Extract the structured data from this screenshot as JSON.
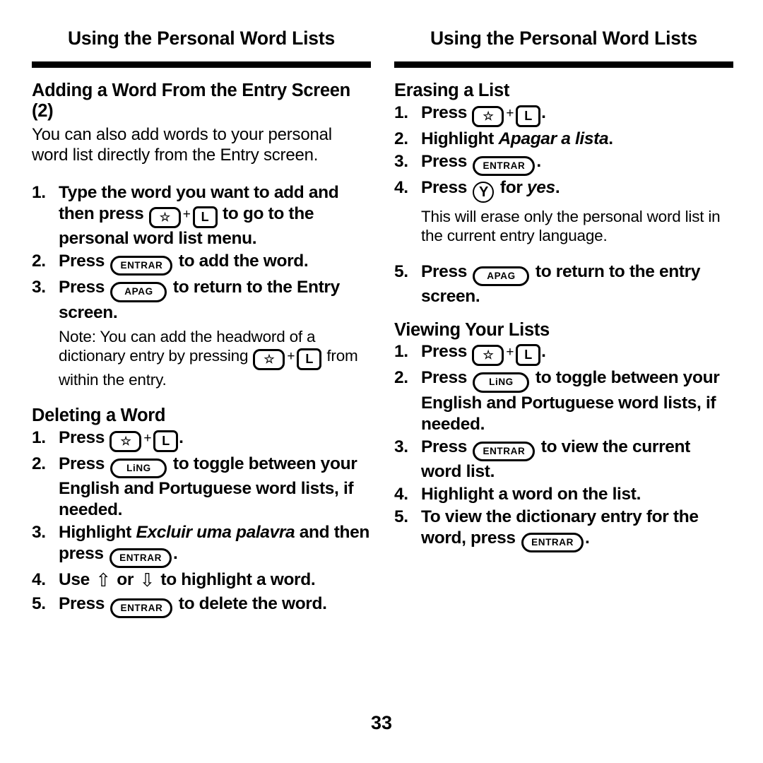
{
  "page": {
    "folio": "33",
    "running_head": "Using the Personal Word Lists"
  },
  "keys": {
    "star": "☆",
    "l": "L",
    "entrar": "ENTRAR",
    "apag": "APAG",
    "ling": "LiNG",
    "y": "Y",
    "plus": "+",
    "arrow_up": "⇧",
    "arrow_down": "⇩"
  },
  "left_column": {
    "header": "Using the Personal Word Lists",
    "section1": {
      "heading": "Adding a Word From the Entry Screen (2)",
      "intro": "You can also add words to your personal word list directly from the Entry screen.",
      "steps": [
        {
          "num": "1.",
          "parts": [
            {
              "t": "text",
              "v": "Type the word you want to add and then press "
            },
            {
              "t": "key",
              "v": "star"
            },
            {
              "t": "plus"
            },
            {
              "t": "key",
              "v": "l"
            },
            {
              "t": "text",
              "v": " to go to the personal word list menu."
            }
          ]
        },
        {
          "num": "2.",
          "parts": [
            {
              "t": "text",
              "v": "Press "
            },
            {
              "t": "key",
              "v": "entrar"
            },
            {
              "t": "text",
              "v": " to add the word."
            }
          ]
        },
        {
          "num": "3.",
          "parts": [
            {
              "t": "text",
              "v": "Press "
            },
            {
              "t": "key",
              "v": "apag"
            },
            {
              "t": "text",
              "v": " to return to the Entry screen."
            }
          ]
        }
      ],
      "note": [
        {
          "t": "text",
          "v": "Note: You can add the headword of a dictionary entry by pressing "
        },
        {
          "t": "key",
          "v": "star"
        },
        {
          "t": "plus"
        },
        {
          "t": "key",
          "v": "l"
        },
        {
          "t": "text",
          "v": " from within the entry."
        }
      ]
    },
    "section2": {
      "heading": "Deleting a Word",
      "steps": [
        {
          "num": "1.",
          "parts": [
            {
              "t": "text",
              "v": "Press "
            },
            {
              "t": "key",
              "v": "star"
            },
            {
              "t": "plus"
            },
            {
              "t": "key",
              "v": "l"
            },
            {
              "t": "text",
              "v": "."
            }
          ]
        },
        {
          "num": "2.",
          "parts": [
            {
              "t": "text",
              "v": "Press "
            },
            {
              "t": "key",
              "v": "ling"
            },
            {
              "t": "text",
              "v": " to toggle between your English and Portuguese word lists, if needed."
            }
          ]
        },
        {
          "num": "3.",
          "parts": [
            {
              "t": "text",
              "v": "Highlight "
            },
            {
              "t": "em",
              "v": "Excluir uma palavra"
            },
            {
              "t": "text",
              "v": " and then press "
            },
            {
              "t": "key",
              "v": "entrar"
            },
            {
              "t": "text",
              "v": "."
            }
          ]
        },
        {
          "num": "4.",
          "parts": [
            {
              "t": "text",
              "v": "Use "
            },
            {
              "t": "arrow",
              "v": "arrow_up"
            },
            {
              "t": "text",
              "v": " or "
            },
            {
              "t": "arrow",
              "v": "arrow_down"
            },
            {
              "t": "text",
              "v": " to highlight a word."
            }
          ]
        },
        {
          "num": "5.",
          "parts": [
            {
              "t": "text",
              "v": "Press "
            },
            {
              "t": "key",
              "v": "entrar"
            },
            {
              "t": "text",
              "v": " to delete the word."
            }
          ]
        }
      ]
    }
  },
  "right_column": {
    "header": "Using the Personal Word Lists",
    "section1": {
      "heading": "Erasing a List",
      "steps": [
        {
          "num": "1.",
          "parts": [
            {
              "t": "text",
              "v": "Press "
            },
            {
              "t": "key",
              "v": "star"
            },
            {
              "t": "plus"
            },
            {
              "t": "key",
              "v": "l"
            },
            {
              "t": "text",
              "v": "."
            }
          ]
        },
        {
          "num": "2.",
          "parts": [
            {
              "t": "text",
              "v": "Highlight "
            },
            {
              "t": "em",
              "v": "Apagar a lista"
            },
            {
              "t": "text",
              "v": "."
            }
          ]
        },
        {
          "num": "3.",
          "parts": [
            {
              "t": "text",
              "v": "Press "
            },
            {
              "t": "key",
              "v": "entrar"
            },
            {
              "t": "text",
              "v": "."
            }
          ]
        },
        {
          "num": "4.",
          "parts": [
            {
              "t": "text",
              "v": "Press "
            },
            {
              "t": "key",
              "v": "y"
            },
            {
              "t": "text",
              "v": " for "
            },
            {
              "t": "em",
              "v": "yes"
            },
            {
              "t": "text",
              "v": "."
            }
          ]
        }
      ],
      "note": [
        {
          "t": "text",
          "v": "This will erase only the personal word list in the current entry language."
        }
      ],
      "steps_after_note": [
        {
          "num": "5.",
          "parts": [
            {
              "t": "text",
              "v": "Press "
            },
            {
              "t": "key",
              "v": "apag"
            },
            {
              "t": "text",
              "v": " to return to the entry screen."
            }
          ]
        }
      ]
    },
    "section2": {
      "heading": "Viewing Your Lists",
      "steps": [
        {
          "num": "1.",
          "parts": [
            {
              "t": "text",
              "v": "Press "
            },
            {
              "t": "key",
              "v": "star"
            },
            {
              "t": "plus"
            },
            {
              "t": "key",
              "v": "l"
            },
            {
              "t": "text",
              "v": "."
            }
          ]
        },
        {
          "num": "2.",
          "parts": [
            {
              "t": "text",
              "v": "Press "
            },
            {
              "t": "key",
              "v": "ling"
            },
            {
              "t": "text",
              "v": " to toggle between your English and Portuguese word lists, if needed."
            }
          ]
        },
        {
          "num": "3.",
          "parts": [
            {
              "t": "text",
              "v": "Press "
            },
            {
              "t": "key",
              "v": "entrar"
            },
            {
              "t": "text",
              "v": " to view the current word list."
            }
          ]
        },
        {
          "num": "4.",
          "parts": [
            {
              "t": "text",
              "v": "Highlight a word on the list."
            }
          ]
        },
        {
          "num": "5.",
          "parts": [
            {
              "t": "text",
              "v": "To view the dictionary entry for the word, press "
            },
            {
              "t": "key",
              "v": "entrar"
            },
            {
              "t": "text",
              "v": "."
            }
          ]
        }
      ]
    }
  }
}
